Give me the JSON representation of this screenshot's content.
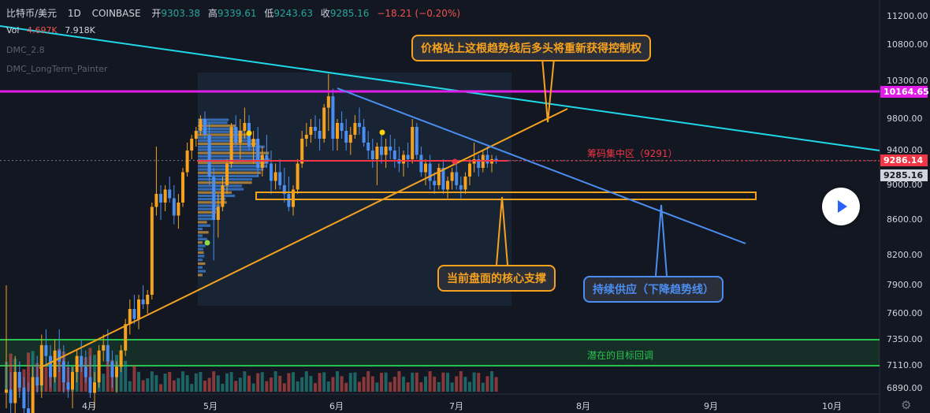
{
  "legend": {
    "symbol": "比特币/美元",
    "interval": "1D",
    "exchange": "COINBASE",
    "open_label": "开",
    "open": "9303.38",
    "high_label": "高",
    "high": "9339.61",
    "low_label": "低",
    "low": "9243.63",
    "close_label": "收",
    "close": "9285.16",
    "change": "−18.21 (−0.20%)"
  },
  "indicators": {
    "vol_label": "Vol",
    "vol_value1": "4.697K",
    "vol_value2": "7.918K",
    "dmc": "DMC_2.8",
    "dmc_long": "DMC_LongTerm_Painter"
  },
  "annotations": {
    "callout_top": "价格站上这根趋势线后多头将重新获得控制权",
    "callout_support": "当前盘面的核心支撑",
    "callout_supply": "持续供应（下降趋势线）",
    "target_zone": "潜在的目标回调",
    "poc": "筹码集中区（9291）"
  },
  "colors": {
    "background": "#131722",
    "up": "#f6a21e",
    "down": "#4b8ef0",
    "magenta_line": "#e11ee8",
    "cyan_line": "#20d8e8",
    "green_zone": "#27c24c",
    "poc_red": "#f23645",
    "support_orange": "#f6a21e"
  },
  "axis": {
    "ticks": [
      "11200.00",
      "10800.00",
      "10300.00",
      "9800.00",
      "9400.00",
      "9000.00",
      "8600.00",
      "8200.00",
      "7900.00",
      "7600.00",
      "7350.00",
      "7110.00",
      "6890.00"
    ],
    "tag_magenta": "10164.65",
    "tag_red": "9286.14",
    "tag_close": "9285.16"
  },
  "x_axis": {
    "months": [
      "4月",
      "5月",
      "6月",
      "7月",
      "8月",
      "9月",
      "10月"
    ]
  },
  "chart_data": {
    "type": "candlestick",
    "x_unit": "daily candles, Mar–Jul 2020",
    "y_ticks": [
      11200,
      10800,
      10300,
      9800,
      9400,
      9000,
      8600,
      8200,
      7900,
      7600,
      7350,
      7110,
      6890
    ],
    "ylim": [
      6800,
      11400
    ],
    "month_labels": [
      "4月",
      "5月",
      "6月",
      "7月",
      "8月",
      "9月",
      "10月"
    ],
    "levels": {
      "resistance_magenta": 10164.65,
      "poc": 9291,
      "current_close": 9285.16,
      "support_zone": [
        8850,
        8950
      ],
      "target_zone": [
        7110,
        7350
      ]
    },
    "ohlc": {
      "open": 9303.38,
      "high": 9339.61,
      "low": 9243.63,
      "close": 9285.16,
      "change": -18.21,
      "change_pct": -0.2
    },
    "candles": [
      {
        "o": 6850,
        "h": 7900,
        "l": 6700,
        "c": 6880
      },
      {
        "o": 6880,
        "h": 7050,
        "l": 6500,
        "c": 6750
      },
      {
        "o": 6750,
        "h": 7200,
        "l": 6600,
        "c": 7050
      },
      {
        "o": 7050,
        "h": 7150,
        "l": 6800,
        "c": 6900
      },
      {
        "o": 6900,
        "h": 7000,
        "l": 6550,
        "c": 6700
      },
      {
        "o": 6700,
        "h": 6950,
        "l": 6480,
        "c": 6650
      },
      {
        "o": 6650,
        "h": 7100,
        "l": 6600,
        "c": 7000
      },
      {
        "o": 7000,
        "h": 7200,
        "l": 6850,
        "c": 6920
      },
      {
        "o": 6920,
        "h": 7400,
        "l": 6800,
        "c": 7300
      },
      {
        "o": 7300,
        "h": 7450,
        "l": 7100,
        "c": 7200
      },
      {
        "o": 7200,
        "h": 7300,
        "l": 6900,
        "c": 7000
      },
      {
        "o": 7000,
        "h": 7350,
        "l": 6950,
        "c": 7250
      },
      {
        "o": 7250,
        "h": 7450,
        "l": 7050,
        "c": 7150
      },
      {
        "o": 7150,
        "h": 7300,
        "l": 6850,
        "c": 6950
      },
      {
        "o": 6950,
        "h": 7150,
        "l": 6800,
        "c": 6880
      },
      {
        "o": 6880,
        "h": 7100,
        "l": 6700,
        "c": 7050
      },
      {
        "o": 7050,
        "h": 7250,
        "l": 6950,
        "c": 7200
      },
      {
        "o": 7200,
        "h": 7350,
        "l": 7050,
        "c": 7100
      },
      {
        "o": 7100,
        "h": 7250,
        "l": 6950,
        "c": 7000
      },
      {
        "o": 7000,
        "h": 7200,
        "l": 6800,
        "c": 6850
      },
      {
        "o": 6850,
        "h": 7050,
        "l": 6700,
        "c": 6950
      },
      {
        "o": 6950,
        "h": 7300,
        "l": 6900,
        "c": 7250
      },
      {
        "o": 7250,
        "h": 7400,
        "l": 7150,
        "c": 7300
      },
      {
        "o": 7300,
        "h": 7450,
        "l": 7100,
        "c": 7150
      },
      {
        "o": 7150,
        "h": 7250,
        "l": 6900,
        "c": 7000
      },
      {
        "o": 7000,
        "h": 7150,
        "l": 6850,
        "c": 7100
      },
      {
        "o": 7100,
        "h": 7300,
        "l": 7050,
        "c": 7250
      },
      {
        "o": 7250,
        "h": 7550,
        "l": 7200,
        "c": 7500
      },
      {
        "o": 7500,
        "h": 7750,
        "l": 7400,
        "c": 7650
      },
      {
        "o": 7650,
        "h": 7800,
        "l": 7500,
        "c": 7550
      },
      {
        "o": 7550,
        "h": 7800,
        "l": 7450,
        "c": 7750
      },
      {
        "o": 7750,
        "h": 7900,
        "l": 7650,
        "c": 7700
      },
      {
        "o": 7700,
        "h": 7850,
        "l": 7600,
        "c": 7800
      },
      {
        "o": 7800,
        "h": 8800,
        "l": 7750,
        "c": 8750
      },
      {
        "o": 8750,
        "h": 9450,
        "l": 8650,
        "c": 8900
      },
      {
        "o": 8900,
        "h": 9000,
        "l": 8600,
        "c": 8800
      },
      {
        "o": 8800,
        "h": 9000,
        "l": 8700,
        "c": 8950
      },
      {
        "o": 8950,
        "h": 9100,
        "l": 8800,
        "c": 8850
      },
      {
        "o": 8850,
        "h": 9000,
        "l": 8550,
        "c": 8650
      },
      {
        "o": 8650,
        "h": 8900,
        "l": 8500,
        "c": 8800
      },
      {
        "o": 8800,
        "h": 9200,
        "l": 8750,
        "c": 9150
      },
      {
        "o": 9150,
        "h": 9500,
        "l": 9100,
        "c": 9400
      },
      {
        "o": 9400,
        "h": 9600,
        "l": 9300,
        "c": 9550
      },
      {
        "o": 9550,
        "h": 9700,
        "l": 9450,
        "c": 9650
      },
      {
        "o": 9650,
        "h": 9850,
        "l": 9600,
        "c": 9800
      },
      {
        "o": 9800,
        "h": 9900,
        "l": 9550,
        "c": 9600
      },
      {
        "o": 9600,
        "h": 9750,
        "l": 9000,
        "c": 9100
      },
      {
        "o": 9100,
        "h": 9200,
        "l": 8150,
        "c": 8600
      },
      {
        "o": 8600,
        "h": 8900,
        "l": 8400,
        "c": 8750
      },
      {
        "o": 8750,
        "h": 9100,
        "l": 8700,
        "c": 9000
      },
      {
        "o": 9000,
        "h": 9300,
        "l": 8900,
        "c": 9250
      },
      {
        "o": 9250,
        "h": 9750,
        "l": 9200,
        "c": 9700
      },
      {
        "o": 9700,
        "h": 9850,
        "l": 9450,
        "c": 9500
      },
      {
        "o": 9500,
        "h": 9800,
        "l": 9300,
        "c": 9650
      },
      {
        "o": 9650,
        "h": 9950,
        "l": 9550,
        "c": 9750
      },
      {
        "o": 9750,
        "h": 9850,
        "l": 9400,
        "c": 9450
      },
      {
        "o": 9450,
        "h": 9650,
        "l": 9250,
        "c": 9550
      },
      {
        "o": 9550,
        "h": 9700,
        "l": 9100,
        "c": 9200
      },
      {
        "o": 9200,
        "h": 9450,
        "l": 9100,
        "c": 9350
      },
      {
        "o": 9350,
        "h": 9600,
        "l": 9200,
        "c": 9250
      },
      {
        "o": 9250,
        "h": 9400,
        "l": 8900,
        "c": 9050
      },
      {
        "o": 9050,
        "h": 9250,
        "l": 8950,
        "c": 9150
      },
      {
        "o": 9150,
        "h": 9300,
        "l": 8950,
        "c": 9000
      },
      {
        "o": 9000,
        "h": 9200,
        "l": 8800,
        "c": 8900
      },
      {
        "o": 8900,
        "h": 9100,
        "l": 8700,
        "c": 8750
      },
      {
        "o": 8750,
        "h": 9000,
        "l": 8650,
        "c": 8950
      },
      {
        "o": 8950,
        "h": 9300,
        "l": 8900,
        "c": 9250
      },
      {
        "o": 9250,
        "h": 9650,
        "l": 9200,
        "c": 9550
      },
      {
        "o": 9550,
        "h": 9750,
        "l": 9450,
        "c": 9600
      },
      {
        "o": 9600,
        "h": 9800,
        "l": 9500,
        "c": 9700
      },
      {
        "o": 9700,
        "h": 9850,
        "l": 9550,
        "c": 9650
      },
      {
        "o": 9650,
        "h": 9800,
        "l": 9400,
        "c": 9550
      },
      {
        "o": 9550,
        "h": 10000,
        "l": 9500,
        "c": 9950
      },
      {
        "o": 9950,
        "h": 10400,
        "l": 9650,
        "c": 10100
      },
      {
        "o": 10100,
        "h": 10200,
        "l": 9400,
        "c": 9550
      },
      {
        "o": 9550,
        "h": 9800,
        "l": 9400,
        "c": 9750
      },
      {
        "o": 9750,
        "h": 9900,
        "l": 9550,
        "c": 9650
      },
      {
        "o": 9650,
        "h": 9800,
        "l": 9400,
        "c": 9500
      },
      {
        "o": 9500,
        "h": 9700,
        "l": 9350,
        "c": 9600
      },
      {
        "o": 9600,
        "h": 9850,
        "l": 9550,
        "c": 9750
      },
      {
        "o": 9750,
        "h": 9950,
        "l": 9600,
        "c": 9700
      },
      {
        "o": 9700,
        "h": 9800,
        "l": 9450,
        "c": 9500
      },
      {
        "o": 9500,
        "h": 9650,
        "l": 9300,
        "c": 9400
      },
      {
        "o": 9400,
        "h": 9550,
        "l": 9200,
        "c": 9300
      },
      {
        "o": 9300,
        "h": 9500,
        "l": 9000,
        "c": 9450
      },
      {
        "o": 9450,
        "h": 9600,
        "l": 9250,
        "c": 9350
      },
      {
        "o": 9350,
        "h": 9550,
        "l": 9200,
        "c": 9450
      },
      {
        "o": 9450,
        "h": 9600,
        "l": 9300,
        "c": 9400
      },
      {
        "o": 9400,
        "h": 9550,
        "l": 9200,
        "c": 9300
      },
      {
        "o": 9300,
        "h": 9450,
        "l": 9150,
        "c": 9250
      },
      {
        "o": 9250,
        "h": 9400,
        "l": 9100,
        "c": 9350
      },
      {
        "o": 9350,
        "h": 9500,
        "l": 9200,
        "c": 9300
      },
      {
        "o": 9300,
        "h": 9800,
        "l": 9250,
        "c": 9700
      },
      {
        "o": 9700,
        "h": 9750,
        "l": 9300,
        "c": 9350
      },
      {
        "o": 9350,
        "h": 9450,
        "l": 9100,
        "c": 9150
      },
      {
        "o": 9150,
        "h": 9300,
        "l": 9000,
        "c": 9250
      },
      {
        "o": 9250,
        "h": 9350,
        "l": 8950,
        "c": 9050
      },
      {
        "o": 9050,
        "h": 9150,
        "l": 8900,
        "c": 9000
      },
      {
        "o": 9000,
        "h": 9250,
        "l": 8950,
        "c": 9200
      },
      {
        "o": 9200,
        "h": 9300,
        "l": 8900,
        "c": 8950
      },
      {
        "o": 8950,
        "h": 9100,
        "l": 8850,
        "c": 9050
      },
      {
        "o": 9050,
        "h": 9200,
        "l": 8950,
        "c": 9150
      },
      {
        "o": 9150,
        "h": 9250,
        "l": 8950,
        "c": 9000
      },
      {
        "o": 9000,
        "h": 9100,
        "l": 8850,
        "c": 8950
      },
      {
        "o": 8950,
        "h": 9150,
        "l": 8900,
        "c": 9100
      },
      {
        "o": 9100,
        "h": 9300,
        "l": 9000,
        "c": 9250
      },
      {
        "o": 9250,
        "h": 9500,
        "l": 9150,
        "c": 9300
      },
      {
        "o": 9300,
        "h": 9350,
        "l": 9100,
        "c": 9200
      },
      {
        "o": 9200,
        "h": 9400,
        "l": 9150,
        "c": 9350
      },
      {
        "o": 9350,
        "h": 9450,
        "l": 9200,
        "c": 9250
      },
      {
        "o": 9250,
        "h": 9350,
        "l": 9150,
        "c": 9300
      },
      {
        "o": 9303.38,
        "h": 9339.61,
        "l": 9243.63,
        "c": 9285.16
      }
    ]
  }
}
